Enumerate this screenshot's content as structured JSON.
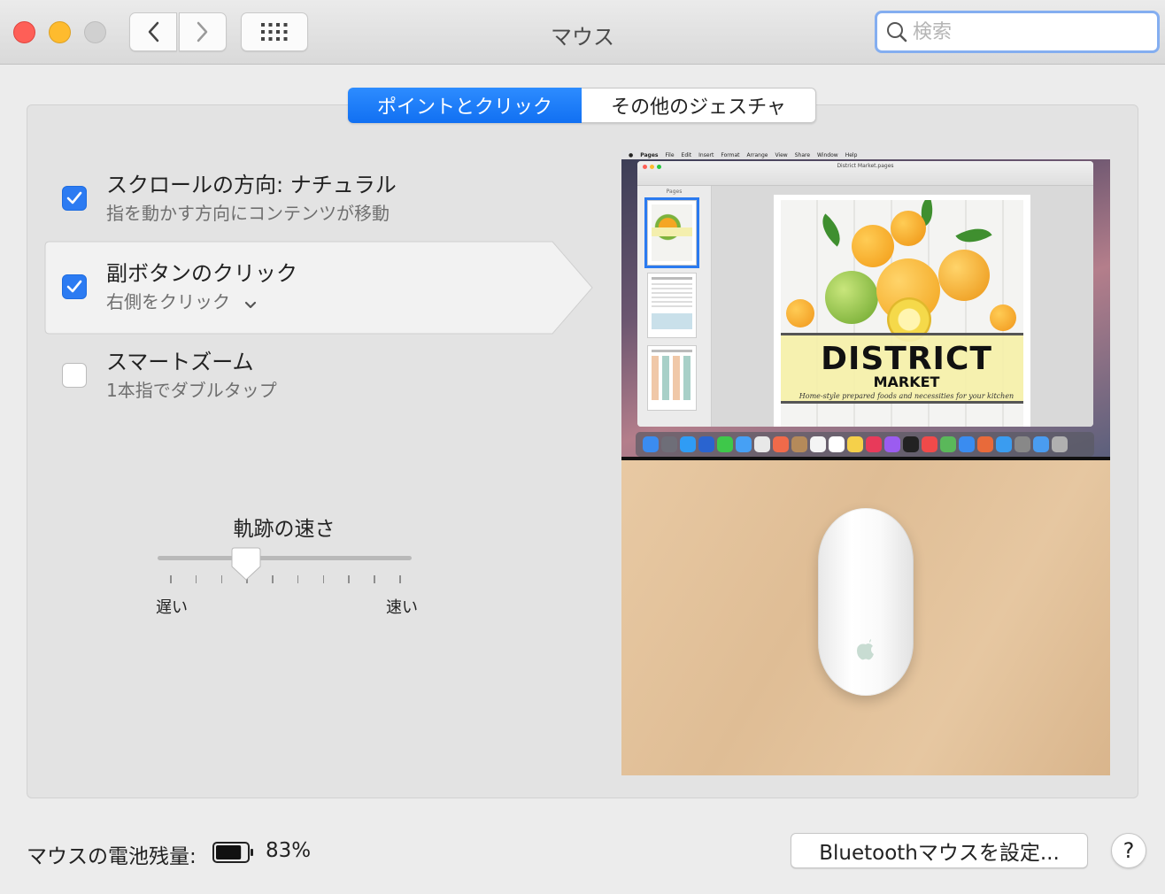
{
  "window": {
    "title": "マウス",
    "search_placeholder": "検索"
  },
  "tabs": [
    {
      "label": "ポイントとクリック",
      "active": true
    },
    {
      "label": "その他のジェスチャ",
      "active": false
    }
  ],
  "options": [
    {
      "title": "スクロールの方向: ナチュラル",
      "subtitle": "指を動かす方向にコンテンツが移動",
      "checked": true
    },
    {
      "title": "副ボタンのクリック",
      "subtitle": "右側をクリック",
      "checked": true,
      "selected": true
    },
    {
      "title": "スマートズーム",
      "subtitle": "1本指でダブルタップ",
      "checked": false
    }
  ],
  "tracking_speed": {
    "label": "軌跡の速さ",
    "min_label": "遅い",
    "max_label": "速い",
    "tick_count": 10,
    "value_fraction": 0.35
  },
  "preview": {
    "banner_title": "DISTRICT",
    "banner_subtitle": "MARKET",
    "banner_tagline": "Home-style prepared foods and necessities for your kitchen",
    "menu_items": [
      "Pages",
      "File",
      "Edit",
      "Insert",
      "Format",
      "Arrange",
      "View",
      "Share",
      "Window",
      "Help"
    ],
    "doc_title": "District Market.pages",
    "sidebar_header": "Pages"
  },
  "footer": {
    "battery_label": "マウスの電池残量:",
    "battery_percent": "83%",
    "battery_level": 0.83,
    "bluetooth_button": "Bluetoothマウスを設定...",
    "help_button": "?"
  },
  "colors": {
    "accent": "#1e78f5",
    "close": "#fe5f57",
    "minimize": "#febb2e",
    "zoom": "#d0d0d0"
  }
}
